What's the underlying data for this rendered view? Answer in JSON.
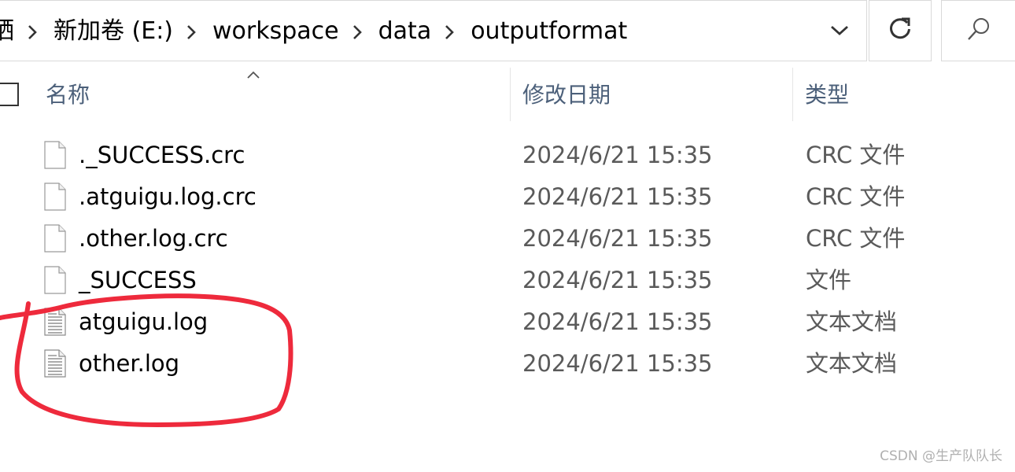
{
  "address_bar": {
    "crumbs": [
      "硒",
      "新加卷 (E:)",
      "workspace",
      "data",
      "outputformat"
    ]
  },
  "columns": {
    "name": "名称",
    "date": "修改日期",
    "type": "类型"
  },
  "files": [
    {
      "name": "._SUCCESS.crc",
      "date": "2024/6/21 15:35",
      "type": "CRC 文件",
      "icon": "blank-file-icon"
    },
    {
      "name": ".atguigu.log.crc",
      "date": "2024/6/21 15:35",
      "type": "CRC 文件",
      "icon": "blank-file-icon"
    },
    {
      "name": ".other.log.crc",
      "date": "2024/6/21 15:35",
      "type": "CRC 文件",
      "icon": "blank-file-icon"
    },
    {
      "name": "_SUCCESS",
      "date": "2024/6/21 15:35",
      "type": "文件",
      "icon": "blank-file-icon"
    },
    {
      "name": "atguigu.log",
      "date": "2024/6/21 15:35",
      "type": "文本文档",
      "icon": "text-file-icon"
    },
    {
      "name": "other.log",
      "date": "2024/6/21 15:35",
      "type": "文本文档",
      "icon": "text-file-icon"
    }
  ],
  "watermark": "CSDN @生产队队长",
  "colors": {
    "annotation": "#ee2a3c",
    "header_text": "#4c607a",
    "meta_text": "#5a5a5a",
    "border": "#d9d9d9"
  },
  "icons": {
    "separator": "chevron-right-icon",
    "dropdown": "chevron-down-icon",
    "refresh": "refresh-icon",
    "search": "search-icon",
    "sort": "sort-up-icon"
  }
}
